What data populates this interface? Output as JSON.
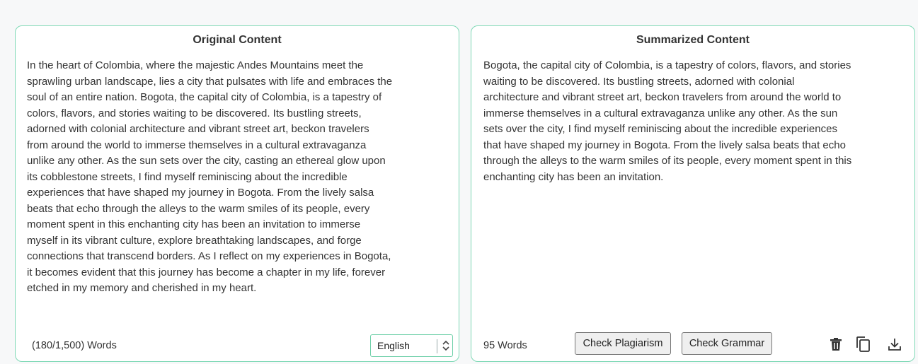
{
  "original": {
    "title": "Original Content",
    "text": "In the heart of Colombia, where the majestic Andes Mountains meet the\nsprawling urban landscape, lies a city that pulsates with life and embraces the\nsoul of an entire nation. Bogota, the capital city of Colombia, is a tapestry of\ncolors, flavors, and stories waiting to be discovered. Its bustling streets,\nadorned with colonial architecture and vibrant street art, beckon travelers\nfrom around the world to immerse themselves in a cultural extravaganza\nunlike any other. As the sun sets over the city, casting an ethereal glow upon\nits cobblestone streets, I find myself reminiscing about the incredible\nexperiences that have shaped my journey in Bogota. From the lively salsa\nbeats that echo through the alleys to the warm smiles of its people, every\nmoment spent in this enchanting city has been an invitation to immerse\nmyself in its vibrant culture, explore breathtaking landscapes, and forge\nconnections that transcend borders. As I reflect on my experiences in Bogota,\nit becomes evident that this journey has become a chapter in my life, forever\netched in my memory and cherished in my heart.",
    "word_count": "(180/1,500) Words",
    "language": "English"
  },
  "summary": {
    "title": "Summarized Content",
    "text": "Bogota, the capital city of Colombia, is a tapestry of colors, flavors, and stories\nwaiting to be discovered. Its bustling streets, adorned with colonial\narchitecture and vibrant street art, beckon travelers from around the world to\nimmerse themselves in a cultural extravaganza unlike any other. As the sun\nsets over the city, I find myself reminiscing about the incredible experiences\nthat have shaped my journey in Bogota. From the lively salsa beats that echo\nthrough the alleys to the warm smiles of its people, every moment spent in this\nenchanting city has been an invitation.",
    "word_count": "95 Words",
    "check_plagiarism_label": "Check Plagiarism",
    "check_grammar_label": "Check Grammar",
    "icons": [
      "trash-icon",
      "copy-icon",
      "download-icon"
    ]
  },
  "colors": {
    "border": "#7fd9b6",
    "background": "#f7f8f9"
  }
}
